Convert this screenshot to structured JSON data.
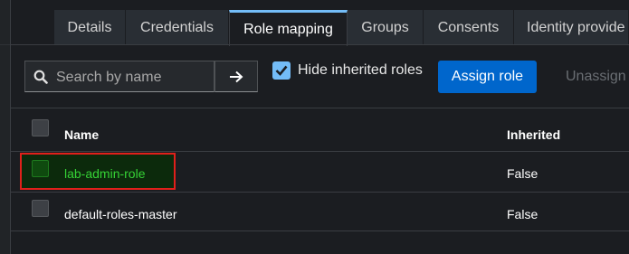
{
  "tabs": [
    {
      "label": "Details",
      "active": false
    },
    {
      "label": "Credentials",
      "active": false
    },
    {
      "label": "Role mapping",
      "active": true
    },
    {
      "label": "Groups",
      "active": false
    },
    {
      "label": "Consents",
      "active": false
    },
    {
      "label": "Identity provide",
      "active": false
    }
  ],
  "toolbar": {
    "search_placeholder": "Search by name",
    "search_value": "",
    "hide_inherited_label": "Hide inherited roles",
    "hide_inherited_checked": true,
    "assign_label": "Assign role",
    "unassign_label": "Unassign"
  },
  "table": {
    "columns": [
      "Name",
      "Inherited"
    ],
    "rows": [
      {
        "name": "lab-admin-role",
        "inherited": "False",
        "highlighted": true
      },
      {
        "name": "default-roles-master",
        "inherited": "False",
        "highlighted": false
      }
    ]
  },
  "colors": {
    "accent": "#0066cc",
    "active_tab_border": "#73bcf7",
    "highlight_border": "#e0201b",
    "highlight_text": "#35d235"
  }
}
